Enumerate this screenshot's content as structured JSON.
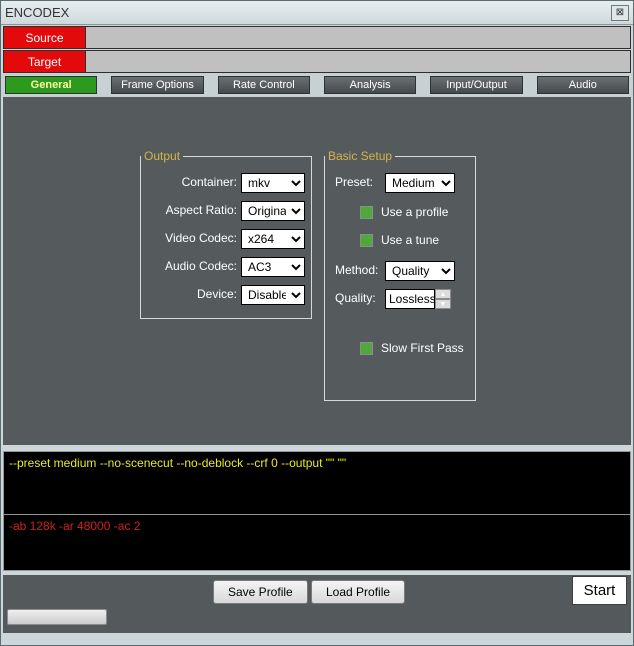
{
  "window": {
    "title": "ENCODEX",
    "close_glyph": "⊠"
  },
  "filebar": {
    "source_label": "Source",
    "target_label": "Target"
  },
  "tabs": [
    {
      "label": "General"
    },
    {
      "label": "Frame Options"
    },
    {
      "label": "Rate Control"
    },
    {
      "label": "Analysis"
    },
    {
      "label": "Input/Output"
    },
    {
      "label": "Audio"
    }
  ],
  "output": {
    "legend": "Output",
    "container": {
      "label": "Container:",
      "value": "mkv"
    },
    "aspect": {
      "label": "Aspect Ratio:",
      "value": "Original"
    },
    "vcodec": {
      "label": "Video Codec:",
      "value": "x264"
    },
    "acodec": {
      "label": "Audio Codec:",
      "value": "AC3"
    },
    "device": {
      "label": "Device:",
      "value": "Disabled"
    }
  },
  "basic": {
    "legend": "Basic Setup",
    "preset": {
      "label": "Preset:",
      "value": "Medium"
    },
    "useprof": {
      "label": "Use a profile"
    },
    "usetune": {
      "label": "Use a tune"
    },
    "method": {
      "label": "Method:",
      "value": "Quality"
    },
    "quality": {
      "label": "Quality:",
      "value": "Lossless"
    },
    "slow": {
      "label": "Slow First Pass"
    }
  },
  "cmd": {
    "video": "--preset medium --no-scenecut --no-deblock --crf 0 --output \"\" \"\"",
    "audio": "-ab 128k -ar 48000 -ac 2"
  },
  "bottom": {
    "save": "Save Profile",
    "load": "Load Profile",
    "start": "Start"
  }
}
